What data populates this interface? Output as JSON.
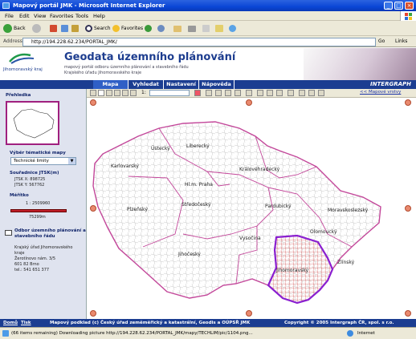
{
  "window": {
    "title": "Mapový portál JMK - Microsoft Internet Explorer"
  },
  "menu": [
    "File",
    "Edit",
    "View",
    "Favorites",
    "Tools",
    "Help"
  ],
  "toolbar": {
    "back": "Back",
    "search": "Search",
    "favorites": "Favorites"
  },
  "address": {
    "label": "Address",
    "url": "http://194.228.62.234/PORTAL_JMK/",
    "go": "Go",
    "links": "Links"
  },
  "header": {
    "logo_text": "Jihomoravský kraj",
    "title": "Geodata územního plánování",
    "subtitle1": "mapový portál odboru územního plánování a stavebního řádu",
    "subtitle2": "Krajského úřadu Jihomoravského kraje"
  },
  "nav": {
    "tabs": [
      "Mapa",
      "Vyhledat",
      "Nastavení",
      "Nápověda"
    ],
    "active": "Mapa",
    "brand": "INTERGRAPH"
  },
  "maptools": {
    "layers_link": "<< Mapové vrstvy"
  },
  "sidebar": {
    "overview_label": "Přehledka",
    "theme_label": "Výběr tématické mapy",
    "theme_value": "Technické limity",
    "coords_label": "Souřadnice JTSK(m)",
    "coord_x": "JTSK X: 898725",
    "coord_y": "JTSK Y: 567762",
    "scale_label": "Měřítko",
    "scale_value": "1 : 2509960",
    "scale_distance": "75299m",
    "contact_title_1": "Odbor územního plánování a",
    "contact_title_2": "stavebního řádu",
    "contact_lines": [
      "Krajský úřad Jihomoravského",
      "kraje",
      "Žerotínovo nám. 3/5",
      "601 82 Brno",
      "tel.: 541 651 377"
    ]
  },
  "map": {
    "cities": [
      "Liberecký",
      "Ústecký",
      "Karlovarský",
      "Královéhradecký",
      "Hl.m. Praha",
      "Středočeský",
      "Plzeňský",
      "Pardubický",
      "Moravskoslezský",
      "Olomoucký",
      "Vysočina",
      "Jihočeský",
      "Zlínský",
      "Jihomoravský"
    ]
  },
  "footer": {
    "home": "Domů",
    "help": "Tisk",
    "credit": "Mapový podklad (c) Český úřad zeměměřický a katastrální, Geodis a OÚPSŘ JMK",
    "copyright": "Copyright © 2005 Intergraph ČR, spol. s r.o."
  },
  "status": {
    "text": "(66 items remaining) Downloading picture http://194.228.62.234/PORTAL_JMK/mapy/TECHLIM/pic/1104.png...",
    "zone": "Internet"
  },
  "colors": {
    "titlebar": "#0a46d6",
    "nav": "#1b3d91",
    "highlight": "#8a1fd0",
    "boundary": "#c3479a"
  }
}
